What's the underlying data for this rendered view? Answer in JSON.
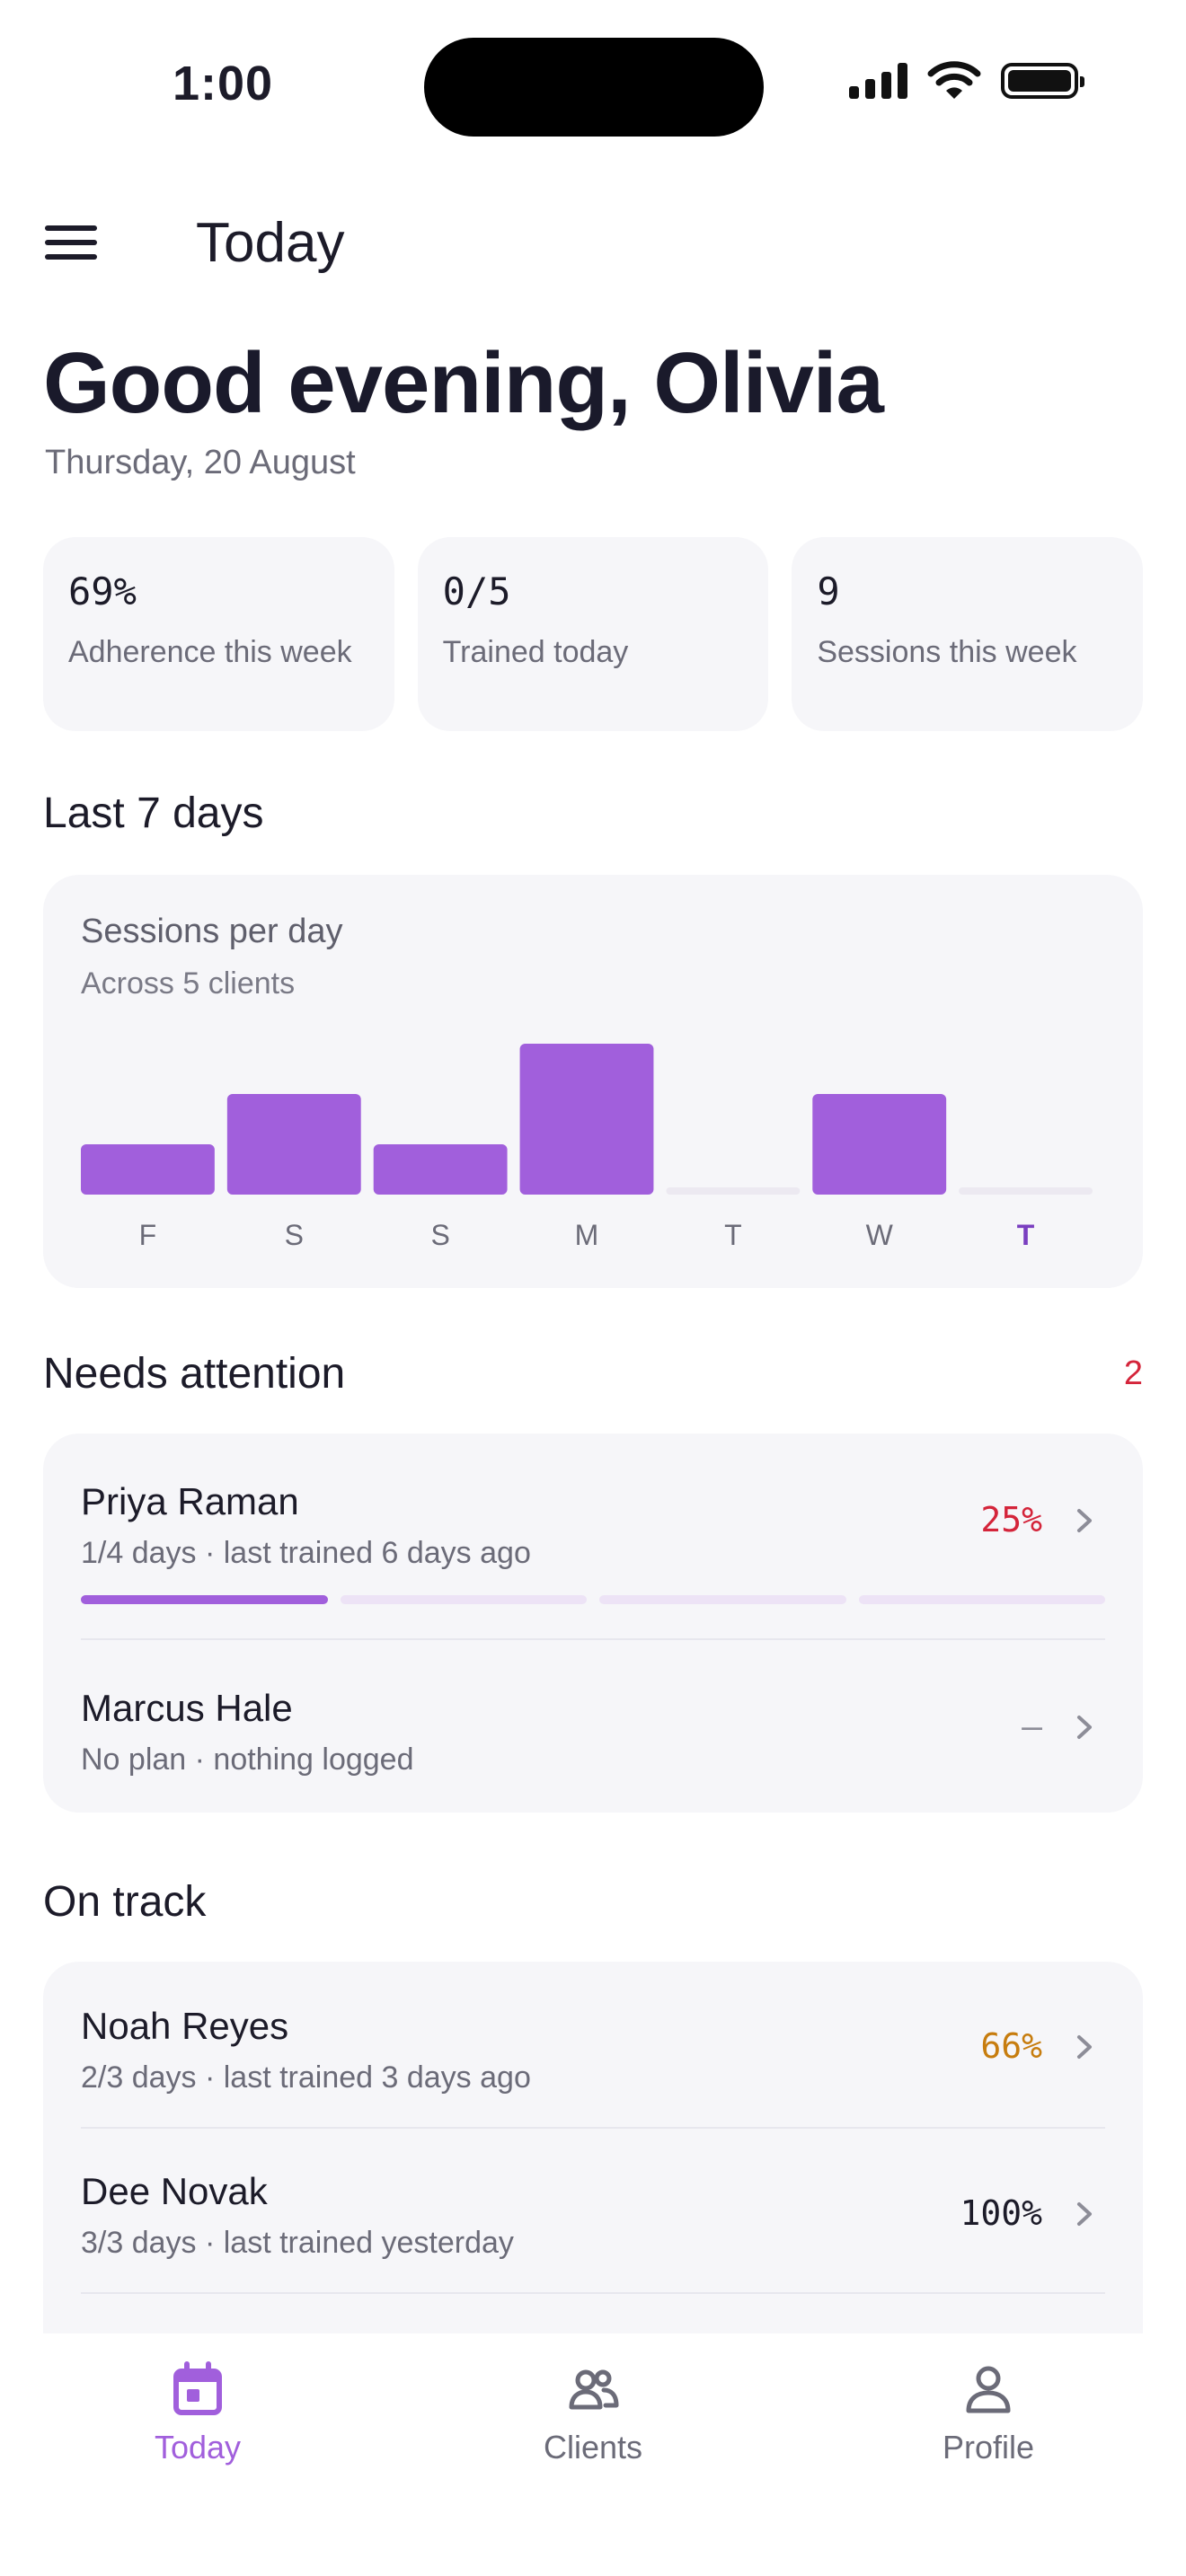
{
  "status_bar": {
    "time": "1:00"
  },
  "header": {
    "title": "Today"
  },
  "greeting": "Good evening, Olivia",
  "date": "Thursday, 20 August",
  "stats": [
    {
      "value": "69%",
      "label": "Adherence this week"
    },
    {
      "value": "0/5",
      "label": "Trained today"
    },
    {
      "value": "9",
      "label": "Sessions this week"
    }
  ],
  "last7": {
    "section_title": "Last 7 days",
    "card_title": "Sessions per day",
    "card_subtitle": "Across 5 clients"
  },
  "chart_data": {
    "type": "bar",
    "title": "Sessions per day",
    "subtitle": "Across 5 clients",
    "categories": [
      "F",
      "S",
      "S",
      "M",
      "T",
      "W",
      "T"
    ],
    "values": [
      1,
      2,
      1,
      3,
      0,
      2,
      0
    ],
    "highlight_index": 6,
    "ylim": [
      0,
      3
    ],
    "grid": false,
    "colors": {
      "bar": "#a15fdc",
      "empty": "#ece9f1",
      "label": "#6b6b78",
      "label_active": "#7a3fc0"
    }
  },
  "needs_attention": {
    "title": "Needs attention",
    "count": "2",
    "clients": [
      {
        "name": "Priya Raman",
        "meta": "1/4 days · last trained 6 days ago",
        "pct": "25%",
        "pct_color": "#d4243a",
        "progress": [
          true,
          false,
          false,
          false
        ]
      },
      {
        "name": "Marcus Hale",
        "meta": "No plan · nothing logged",
        "pct": "–",
        "pct_color": "#8d8d98",
        "progress": []
      }
    ]
  },
  "on_track": {
    "title": "On track",
    "clients": [
      {
        "name": "Noah Reyes",
        "meta": "2/3 days · last trained 3 days ago",
        "pct": "66%",
        "pct_color": "#c77d0f"
      },
      {
        "name": "Dee Novak",
        "meta": "3/3 days · last trained yesterday",
        "pct": "100%",
        "pct_color": "#1c1b29"
      }
    ]
  },
  "tabs": [
    {
      "label": "Today",
      "icon": "calendar-icon",
      "active": true
    },
    {
      "label": "Clients",
      "icon": "people-icon",
      "active": false
    },
    {
      "label": "Profile",
      "icon": "person-icon",
      "active": false
    }
  ],
  "colors": {
    "accent": "#a15fdc",
    "danger": "#d4243a",
    "warning": "#c77d0f"
  }
}
